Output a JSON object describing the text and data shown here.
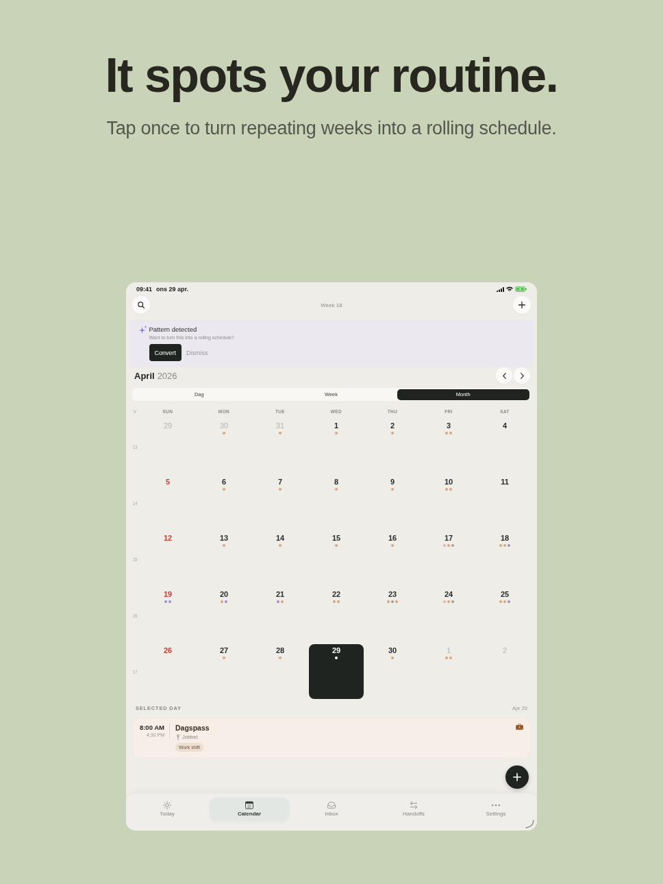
{
  "hero": {
    "title": "It spots your routine.",
    "subtitle": "Tap once to turn repeating weeks into a rolling schedule."
  },
  "status_bar": {
    "time": "09:41",
    "date": "ons 29 apr."
  },
  "top_bar": {
    "title": "Week 18"
  },
  "pattern_banner": {
    "title": "Pattern detected",
    "message": "Want to turn this into a rolling schedule?",
    "buttons": [
      {
        "label": "Convert",
        "kind": "primary"
      },
      {
        "label": "Dismiss",
        "kind": "text"
      }
    ]
  },
  "month_header": {
    "month": "April",
    "year": "2026"
  },
  "view_tabs": [
    {
      "label": "Dag",
      "selected": false
    },
    {
      "label": "Week",
      "selected": false
    },
    {
      "label": "Month",
      "selected": true
    }
  ],
  "calendar": {
    "week_column": "V",
    "weekdays": [
      "SUN",
      "MON",
      "TUE",
      "WED",
      "THU",
      "FRI",
      "SAT"
    ],
    "weeks": [
      {
        "number": "13",
        "days": [
          {
            "label": "29",
            "kind": "outside",
            "selected": false
          },
          {
            "label": "30",
            "kind": "outside",
            "selected": false,
            "dots": [
              {
                "color": "#d9a47c"
              }
            ]
          },
          {
            "label": "31",
            "kind": "outside",
            "selected": false,
            "dots": [
              {
                "color": "#d9a47c"
              }
            ]
          },
          {
            "label": "1",
            "kind": "regular",
            "selected": false,
            "dots": [
              {
                "color": "#d9a47c"
              }
            ]
          },
          {
            "label": "2",
            "kind": "regular",
            "selected": false,
            "dots": [
              {
                "color": "#d9a47c"
              }
            ]
          },
          {
            "label": "3",
            "kind": "regular",
            "selected": false,
            "dots": [
              {
                "color": "#d9a47c"
              },
              {
                "color": "#d9a47c"
              }
            ]
          },
          {
            "label": "4",
            "kind": "regular",
            "selected": false
          }
        ]
      },
      {
        "number": "14",
        "days": [
          {
            "label": "5",
            "kind": "sunday",
            "selected": false
          },
          {
            "label": "6",
            "kind": "regular",
            "selected": false,
            "dots": [
              {
                "color": "#d9a47c"
              }
            ]
          },
          {
            "label": "7",
            "kind": "regular",
            "selected": false,
            "dots": [
              {
                "color": "#d9a47c"
              }
            ]
          },
          {
            "label": "8",
            "kind": "regular",
            "selected": false,
            "dots": [
              {
                "color": "#d9a47c"
              }
            ]
          },
          {
            "label": "9",
            "kind": "regular",
            "selected": false,
            "dots": [
              {
                "color": "#d9a47c"
              }
            ]
          },
          {
            "label": "10",
            "kind": "regular",
            "selected": false,
            "dots": [
              {
                "color": "#d9a47c"
              },
              {
                "color": "#d9a47c"
              }
            ]
          },
          {
            "label": "11",
            "kind": "regular",
            "selected": false
          }
        ]
      },
      {
        "number": "15",
        "days": [
          {
            "label": "12",
            "kind": "sunday",
            "selected": false
          },
          {
            "label": "13",
            "kind": "regular",
            "selected": false,
            "dots": [
              {
                "color": "#d9a47c"
              }
            ]
          },
          {
            "label": "14",
            "kind": "regular",
            "selected": false,
            "dots": [
              {
                "color": "#d9a47c"
              }
            ]
          },
          {
            "label": "15",
            "kind": "regular",
            "selected": false,
            "dots": [
              {
                "color": "#d9a47c"
              }
            ]
          },
          {
            "label": "16",
            "kind": "regular",
            "selected": false,
            "dots": [
              {
                "color": "#d9a47c"
              }
            ]
          },
          {
            "label": "17",
            "kind": "regular",
            "selected": false,
            "dots": [
              {
                "color": "#e6b3a6"
              },
              {
                "color": "#d9a47c"
              },
              {
                "color": "#a3a09a"
              }
            ]
          },
          {
            "label": "18",
            "kind": "regular",
            "selected": false,
            "dots": [
              {
                "color": "#d9a47c"
              },
              {
                "color": "#d9a47c"
              },
              {
                "color": "#9c8fd4"
              }
            ]
          }
        ]
      },
      {
        "number": "16",
        "days": [
          {
            "label": "19",
            "kind": "sunday",
            "selected": false,
            "dots": [
              {
                "color": "#9c8fd4"
              },
              {
                "color": "#9c8fd4"
              }
            ]
          },
          {
            "label": "20",
            "kind": "regular",
            "selected": false,
            "dots": [
              {
                "color": "#d9a47c"
              },
              {
                "color": "#9c8fd4"
              }
            ]
          },
          {
            "label": "21",
            "kind": "regular",
            "selected": false,
            "dots": [
              {
                "color": "#9c8fd4"
              },
              {
                "color": "#d9a47c"
              }
            ]
          },
          {
            "label": "22",
            "kind": "regular",
            "selected": false,
            "dots": [
              {
                "color": "#d9a47c"
              },
              {
                "color": "#d9a47c"
              }
            ]
          },
          {
            "label": "23",
            "kind": "regular",
            "selected": false,
            "dots": [
              {
                "color": "#d9a47c"
              },
              {
                "color": "#a3a09a"
              },
              {
                "color": "#d9a47c"
              }
            ]
          },
          {
            "label": "24",
            "kind": "regular",
            "selected": false,
            "dots": [
              {
                "color": "#e6b3a6"
              },
              {
                "color": "#d9a47c"
              },
              {
                "color": "#a3a09a"
              }
            ]
          },
          {
            "label": "25",
            "kind": "regular",
            "selected": false,
            "dots": [
              {
                "color": "#d9a47c"
              },
              {
                "color": "#d9a47c"
              },
              {
                "color": "#9c8fd4"
              }
            ]
          }
        ]
      },
      {
        "number": "17",
        "days": [
          {
            "label": "26",
            "kind": "sunday",
            "selected": false
          },
          {
            "label": "27",
            "kind": "regular",
            "selected": false,
            "dots": [
              {
                "color": "#d9a47c"
              }
            ]
          },
          {
            "label": "28",
            "kind": "regular",
            "selected": false,
            "dots": [
              {
                "color": "#d9a47c"
              }
            ]
          },
          {
            "label": "29",
            "kind": "regular",
            "selected": true,
            "dots": [
              {
                "color": "#ffffff"
              }
            ]
          },
          {
            "label": "30",
            "kind": "regular",
            "selected": false,
            "dots": [
              {
                "color": "#d9a47c"
              }
            ]
          },
          {
            "label": "1",
            "kind": "outside",
            "selected": false,
            "dots": [
              {
                "color": "#d9a47c"
              },
              {
                "color": "#d9a47c"
              }
            ]
          },
          {
            "label": "2",
            "kind": "outside",
            "selected": false
          }
        ]
      }
    ]
  },
  "selected_day": {
    "heading": "SELECTED DAY",
    "date": "Apr 29",
    "events": [
      {
        "start": "8:00 AM",
        "end": "4:30 PM",
        "title": "Dagspass",
        "location": "Jobbet",
        "tag": "Work shift"
      }
    ]
  },
  "tab_bar": [
    {
      "label": "Today",
      "selected": false
    },
    {
      "label": "Calendar",
      "selected": true
    },
    {
      "label": "Inbox",
      "selected": false
    },
    {
      "label": "Handoffs",
      "selected": false
    },
    {
      "label": "Settings",
      "selected": false
    }
  ]
}
